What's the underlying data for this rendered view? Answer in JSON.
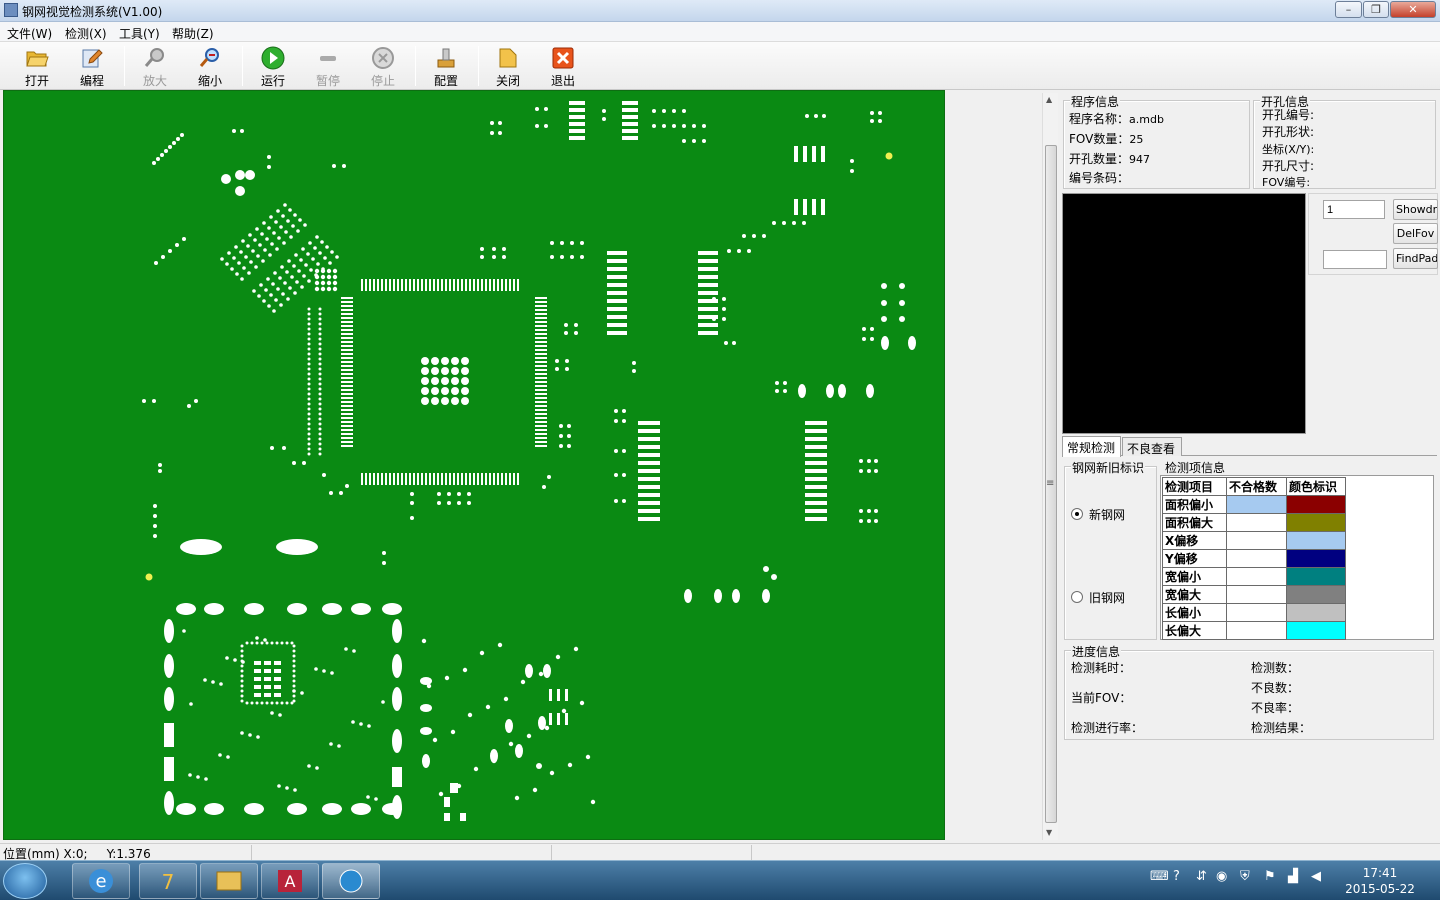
{
  "window": {
    "title": "钢网视觉检测系统(V1.00)"
  },
  "menu": [
    "文件(W)",
    "检测(X)",
    "工具(Y)",
    "帮助(Z)"
  ],
  "toolbar": [
    {
      "label": "打开",
      "icon": "folder-open-icon",
      "enabled": true
    },
    {
      "label": "编程",
      "icon": "edit-pencil-icon",
      "enabled": true
    },
    {
      "label": "放大",
      "icon": "zoom-in-icon",
      "enabled": false
    },
    {
      "label": "缩小",
      "icon": "zoom-out-icon",
      "enabled": true
    },
    {
      "label": "运行",
      "icon": "play-icon",
      "enabled": true
    },
    {
      "label": "暂停",
      "icon": "pause-icon",
      "enabled": false
    },
    {
      "label": "停止",
      "icon": "stop-icon",
      "enabled": false
    },
    {
      "label": "配置",
      "icon": "config-icon",
      "enabled": true
    },
    {
      "label": "关闭",
      "icon": "close-folder-icon",
      "enabled": true
    },
    {
      "label": "退出",
      "icon": "exit-icon",
      "enabled": true
    }
  ],
  "program_info": {
    "caption": "程序信息",
    "name_label": "程序名称：",
    "name_value": "a.mdb",
    "fov_label": "FOV数量：",
    "fov_value": "25",
    "hole_label": "开孔数量：",
    "hole_value": "947",
    "code_label": "编号条码："
  },
  "hole_info": {
    "caption": "开孔信息",
    "labels": [
      "开孔编号:",
      "开孔形状:",
      "坐标(X/Y):",
      "开孔尺寸:",
      "FOV编号:"
    ]
  },
  "fov_panel": {
    "input1_value": "1",
    "input2_value": "",
    "btn_draw": "ShowdrawFov",
    "btn_del": "DelFov",
    "btn_find": "FindPad"
  },
  "tabs": [
    "常规检测",
    "不良查看"
  ],
  "stencil_type": {
    "caption": "钢网新旧标识",
    "new_label": "新钢网",
    "old_label": "旧钢网",
    "selected": "new"
  },
  "inspection": {
    "caption": "检测项信息",
    "headers": [
      "检测项目",
      "不合格数",
      "颜色标识"
    ],
    "rows": [
      {
        "name": "面积偏小",
        "count": "",
        "color": "#8b0000"
      },
      {
        "name": "面积偏大",
        "count": "",
        "color": "#808000"
      },
      {
        "name": "X偏移",
        "count": "",
        "color": "#a6caf0"
      },
      {
        "name": "Y偏移",
        "count": "",
        "color": "#000080"
      },
      {
        "name": "宽偏小",
        "count": "",
        "color": "#008080"
      },
      {
        "name": "宽偏大",
        "count": "",
        "color": "#808080"
      },
      {
        "name": "长偏小",
        "count": "",
        "color": "#c0c0c0"
      },
      {
        "name": "长偏大",
        "count": "",
        "color": "#00ffff"
      }
    ],
    "first_row_count_color": "#a6caf0"
  },
  "progress": {
    "caption": "进度信息",
    "time_label": "检测耗时：",
    "fov_label": "当前FOV：",
    "rate_label": "检测进行率：",
    "count_label": "检测数：",
    "bad_label": "不良数：",
    "badrate_label": "不良率：",
    "result_label": "检测结果："
  },
  "status": {
    "position": "位置(mm) X:0;     Y:1.376"
  },
  "taskbar": {
    "time": "17:41",
    "date": "2015-05-22"
  },
  "colors": {
    "board": "#0a8a13",
    "pad": "#ffffff",
    "fiducial": "#f0f050"
  }
}
